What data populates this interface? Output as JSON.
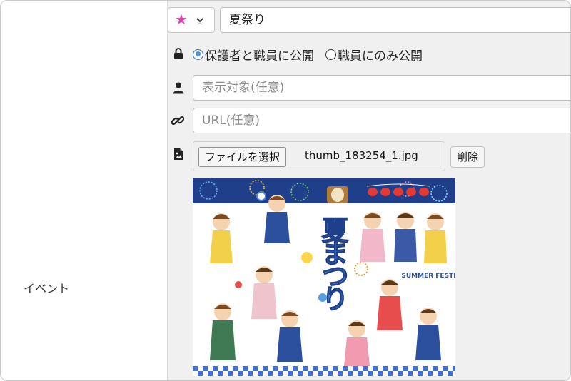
{
  "row_label": "イベント",
  "stamp": {
    "icon": "star-icon",
    "color": "#e040b5"
  },
  "title_input": {
    "value": "夏祭り"
  },
  "visibility": {
    "option_1": "保護者と職員に公開",
    "option_2": "職員にのみ公開",
    "selected": "option_1"
  },
  "target_input": {
    "placeholder": "表示対象(任意)"
  },
  "url_input": {
    "placeholder": "URL(任意)"
  },
  "file": {
    "choose_label": "ファイルを選択",
    "file_name": "thumb_183254_1.jpg",
    "delete_label": "削除"
  },
  "thumbnail": {
    "title_text": "夏まつり",
    "subtitle_text": "SUMMER FESTIVAL"
  }
}
